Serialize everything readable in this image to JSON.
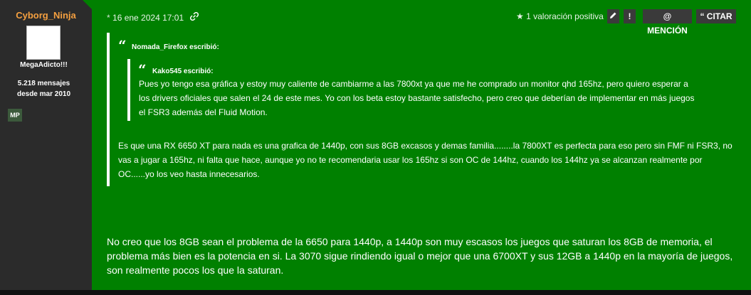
{
  "user": {
    "name": "Cyborg_Ninja",
    "title": "MegaAdicto!!!",
    "posts": "5.218 mensajes",
    "since": "desde mar 2010",
    "mp_label": "MP"
  },
  "post": {
    "date": "16 ene 2024 17:01",
    "rating": "1 valoración positiva",
    "mention_label": "MENCIÓN",
    "quote_label": "CITAR",
    "outer_quote": {
      "author": "Nomada_Firefox escribió:",
      "text": "Es que una RX 6650 XT para nada es una grafica de 1440p, con sus 8GB excasos y demas familia........la 7800XT es perfecta para eso pero sin FMF ni FSR3, no vas a jugar a 165hz, ni falta que hace, aunque yo no te recomendaria usar los 165hz si son OC de 144hz, cuando los 144hz ya se alcanzan realmente por OC......yo los veo hasta innecesarios."
    },
    "inner_quote": {
      "author": "Kako545 escribió:",
      "text": "Pues yo tengo esa gráfica y estoy muy caliente de cambiarme a las 7800xt ya que me he comprado un monitor qhd 165hz, pero quiero esperar a los drivers oficiales que salen el 24 de este mes. Yo con los beta estoy bastante satisfecho, pero creo que deberían de implementar en más juegos el FSR3 además del Fluid Motion."
    },
    "body": "No creo que los 8GB sean el problema de la 6650 para 1440p, a 1440p son muy escasos los juegos que saturan los 8GB de memoria, el problema más bien es la potencia en si. La 3070 sigue rindiendo igual o mejor que una 6700XT y sus 12GB a 1440p en la mayoría de juegos, son realmente pocos los que la saturan."
  }
}
